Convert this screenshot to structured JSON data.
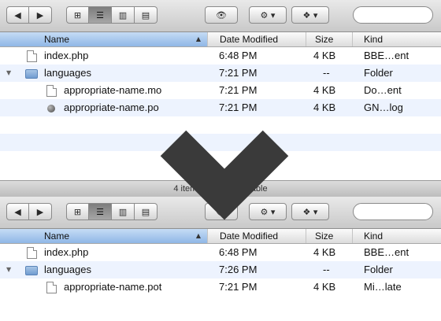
{
  "toolbar": {
    "back_icon": "back-arrow-icon",
    "forward_icon": "forward-arrow-icon",
    "views": [
      "icon-view-icon",
      "list-view-icon",
      "column-view-icon",
      "coverflow-view-icon"
    ],
    "quicklook_icon": "eye-icon",
    "action_icon": "gear-icon",
    "dropbox_icon": "dropbox-icon",
    "search_placeholder": ""
  },
  "columns": {
    "name": "Name",
    "date": "Date Modified",
    "size": "Size",
    "kind": "Kind"
  },
  "before": {
    "rows": [
      {
        "icon": "php-file-icon",
        "name": "index.php",
        "date": "6:48 PM",
        "size": "4 KB",
        "kind": "BBE…ent",
        "level": 0
      },
      {
        "icon": "folder-icon",
        "name": "languages",
        "date": "7:21 PM",
        "size": "--",
        "kind": "Folder",
        "level": 0,
        "expanded": true
      },
      {
        "icon": "document-icon",
        "name": "appropriate-name.mo",
        "date": "7:21 PM",
        "size": "4 KB",
        "kind": "Do…ent",
        "level": 1
      },
      {
        "icon": "bundle-icon",
        "name": "appropriate-name.po",
        "date": "7:21 PM",
        "size": "4 KB",
        "kind": "GN…log",
        "level": 1
      }
    ],
    "status": "4 items, 45 GB available"
  },
  "after": {
    "rows": [
      {
        "icon": "php-file-icon",
        "name": "index.php",
        "date": "6:48 PM",
        "size": "4 KB",
        "kind": "BBE…ent",
        "level": 0
      },
      {
        "icon": "folder-icon",
        "name": "languages",
        "date": "7:26 PM",
        "size": "--",
        "kind": "Folder",
        "level": 0,
        "expanded": true
      },
      {
        "icon": "document-icon",
        "name": "appropriate-name.pot",
        "date": "7:21 PM",
        "size": "4 KB",
        "kind": "Mi…late",
        "level": 1
      }
    ]
  },
  "overlay": {
    "icon": "chevron-down-icon",
    "color": "#3a3a3a"
  },
  "colors": {
    "header_selected": "#a9c9ef",
    "row_alt": "#edf3fe"
  }
}
